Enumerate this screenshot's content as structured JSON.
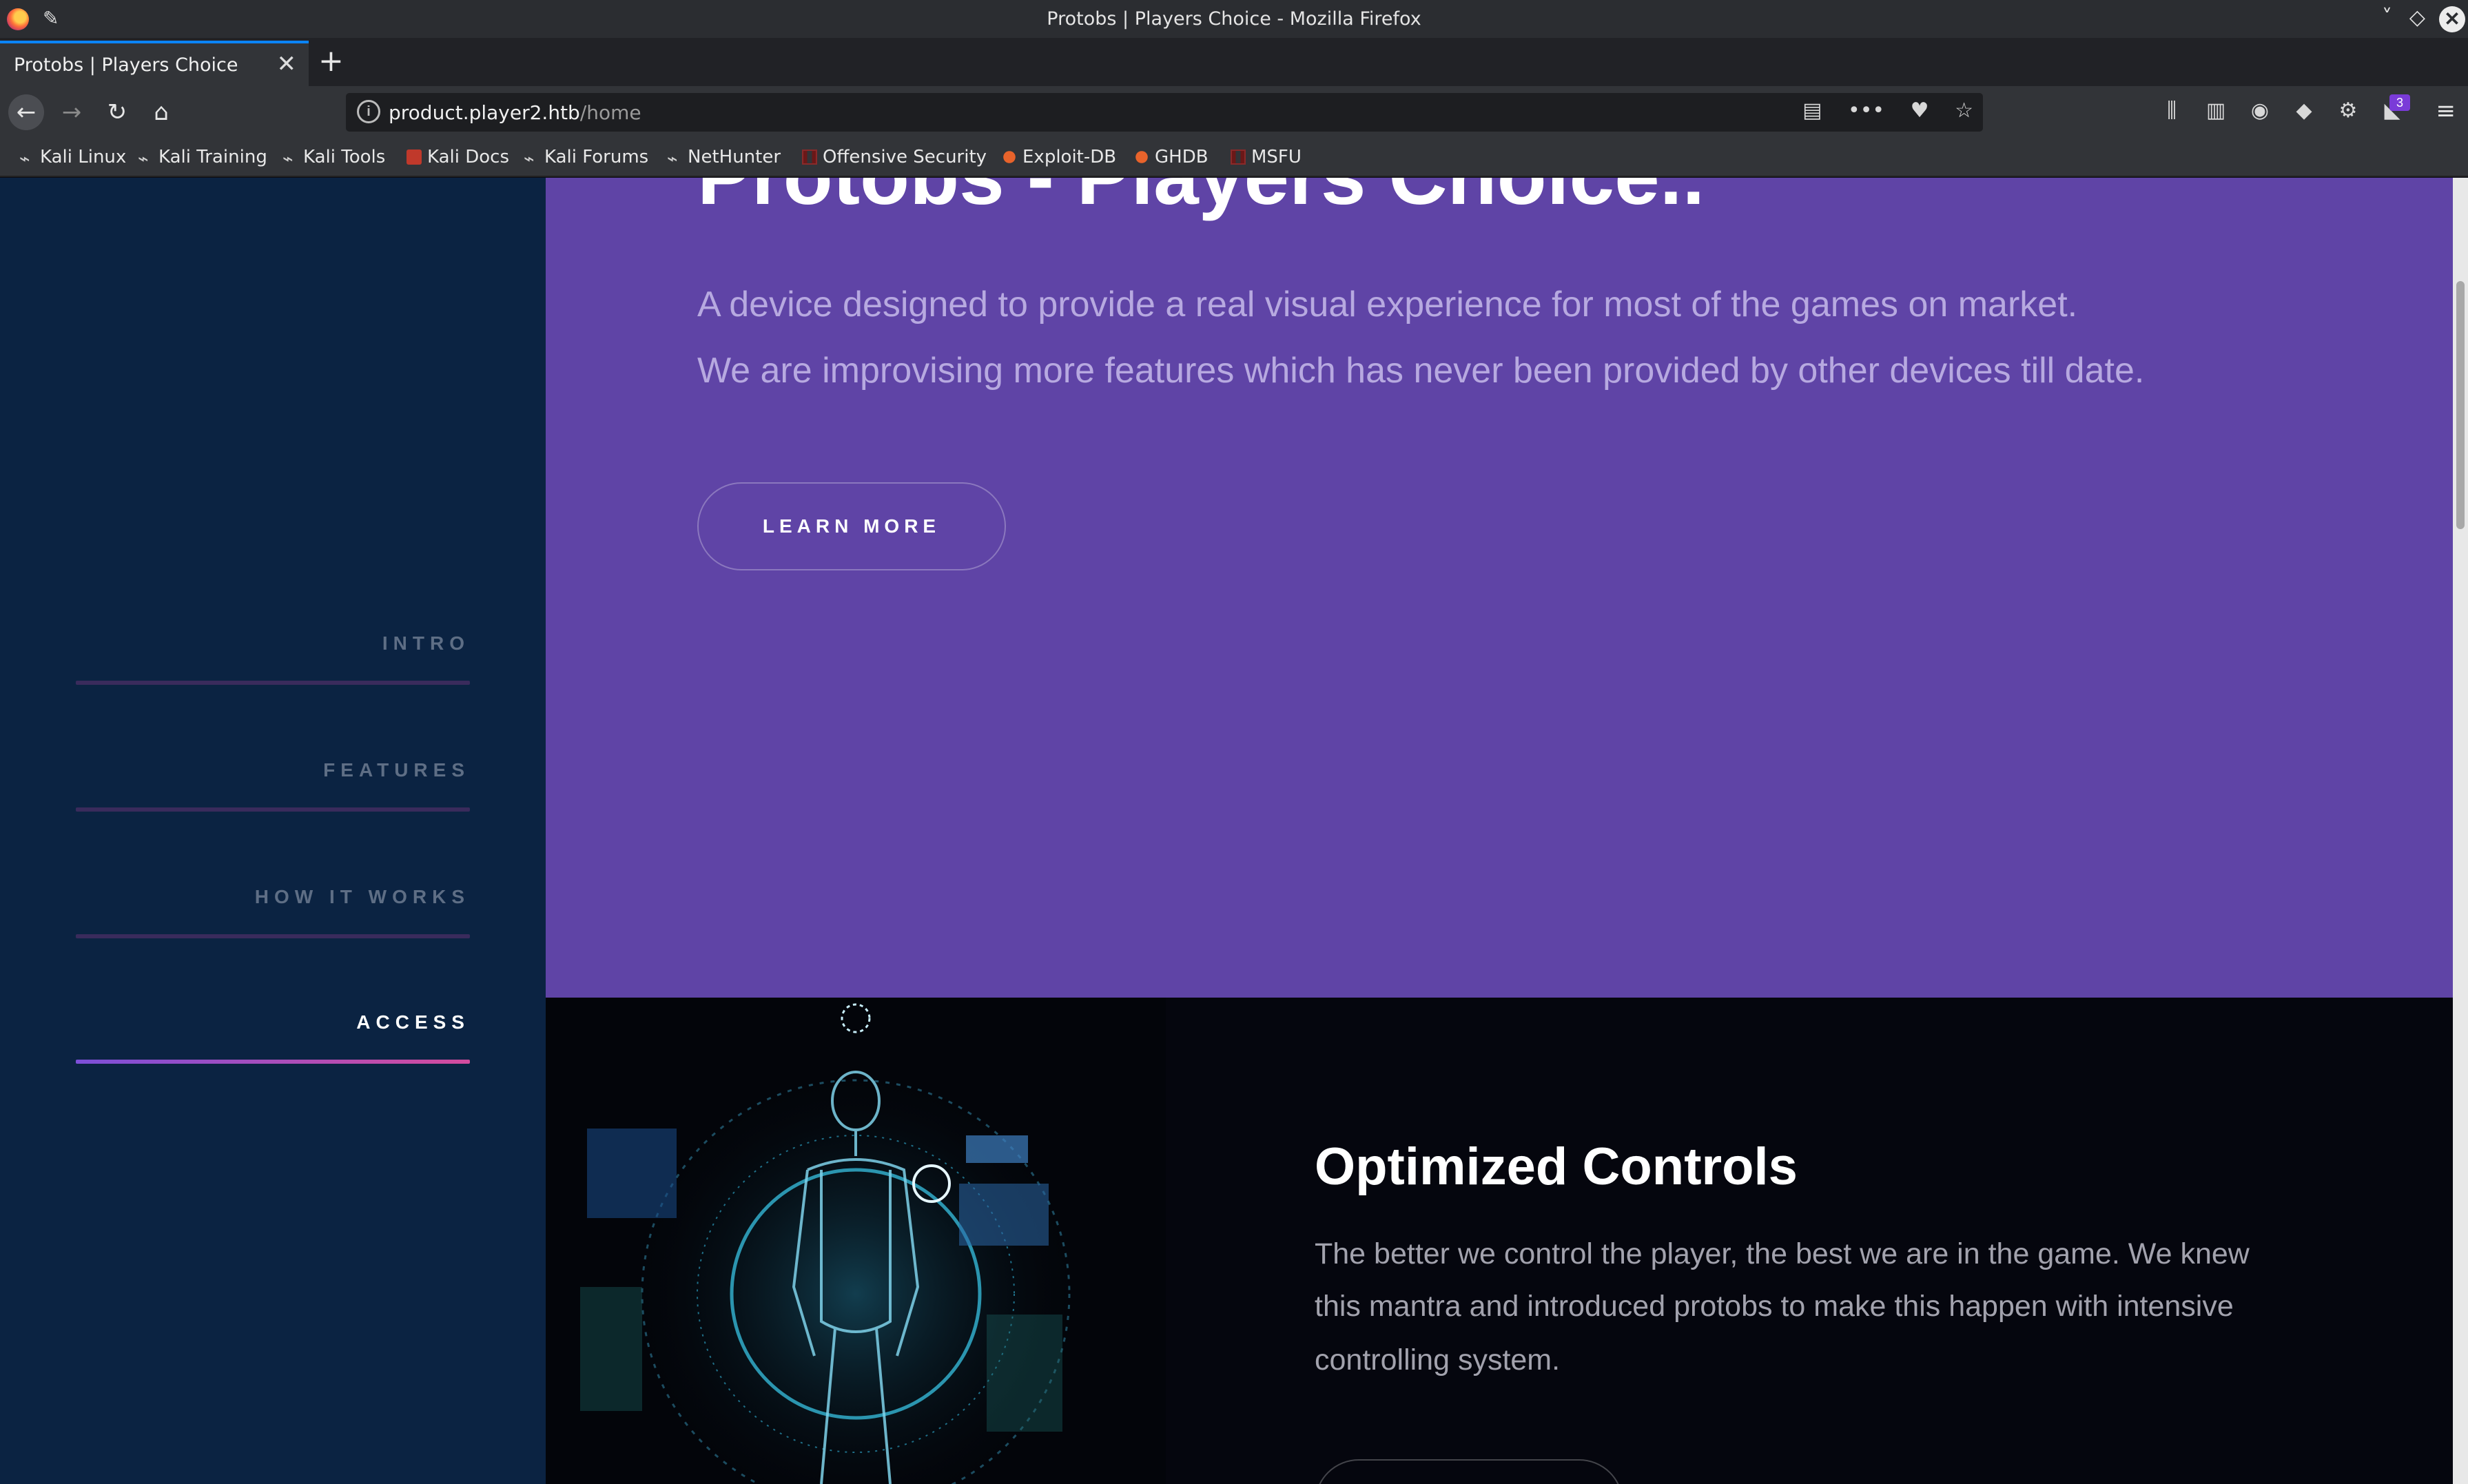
{
  "window": {
    "title": "Protobs | Players Choice - Mozilla Firefox",
    "controls": [
      "˅",
      "◇",
      "✕"
    ]
  },
  "tab": {
    "title": "Protobs | Players Choice",
    "close": "✕",
    "new_tab": "+"
  },
  "nav": {
    "back": "←",
    "forward": "→",
    "reload": "↻",
    "home": "⌂",
    "url_host": "product.player2.htb",
    "url_path": "/home",
    "url_icons": [
      "▤",
      "•••",
      "♥",
      "☆"
    ],
    "toolbar_icons": [
      "⫼",
      "▥",
      "◉",
      "◆",
      "⚙",
      "◣"
    ],
    "addon_badge": "3",
    "menu": "≡"
  },
  "bookmarks": [
    {
      "label": "Kali Linux",
      "icon": "kali-dragon-icon"
    },
    {
      "label": "Kali Training",
      "icon": "kali-dragon-icon"
    },
    {
      "label": "Kali Tools",
      "icon": "kali-dragon-icon"
    },
    {
      "label": "Kali Docs",
      "icon": "kali-docs-icon"
    },
    {
      "label": "Kali Forums",
      "icon": "kali-dragon-icon"
    },
    {
      "label": "NetHunter",
      "icon": "kali-dragon-icon"
    },
    {
      "label": "Offensive Security",
      "icon": "offsec-icon"
    },
    {
      "label": "Exploit-DB",
      "icon": "exploitdb-icon"
    },
    {
      "label": "GHDB",
      "icon": "exploitdb-icon"
    },
    {
      "label": "MSFU",
      "icon": "offsec-icon"
    }
  ],
  "sidebar": {
    "items": [
      {
        "label": "INTRO",
        "active": false
      },
      {
        "label": "FEATURES",
        "active": false
      },
      {
        "label": "HOW IT WORKS",
        "active": false
      },
      {
        "label": "ACCESS",
        "active": true
      }
    ]
  },
  "hero": {
    "title": "Protobs - Players Choice..",
    "line1": "A device designed to provide a real visual experience for most of the games on market.",
    "line2": "We are improvising more features which has never been provided by other devices till date.",
    "button": "LEARN MORE"
  },
  "feature": {
    "title": "Optimized Controls",
    "lines": [
      "The better we control the player, the best we are in the game. We knew",
      "this mantra and introduced protobs to make this happen with intensive",
      "controlling system."
    ]
  },
  "colors": {
    "hero_bg": "#5f44a6",
    "sidebar_bg": "#0b2342",
    "feature_bg": "#05060e",
    "active_underline": "#d44c9e"
  }
}
